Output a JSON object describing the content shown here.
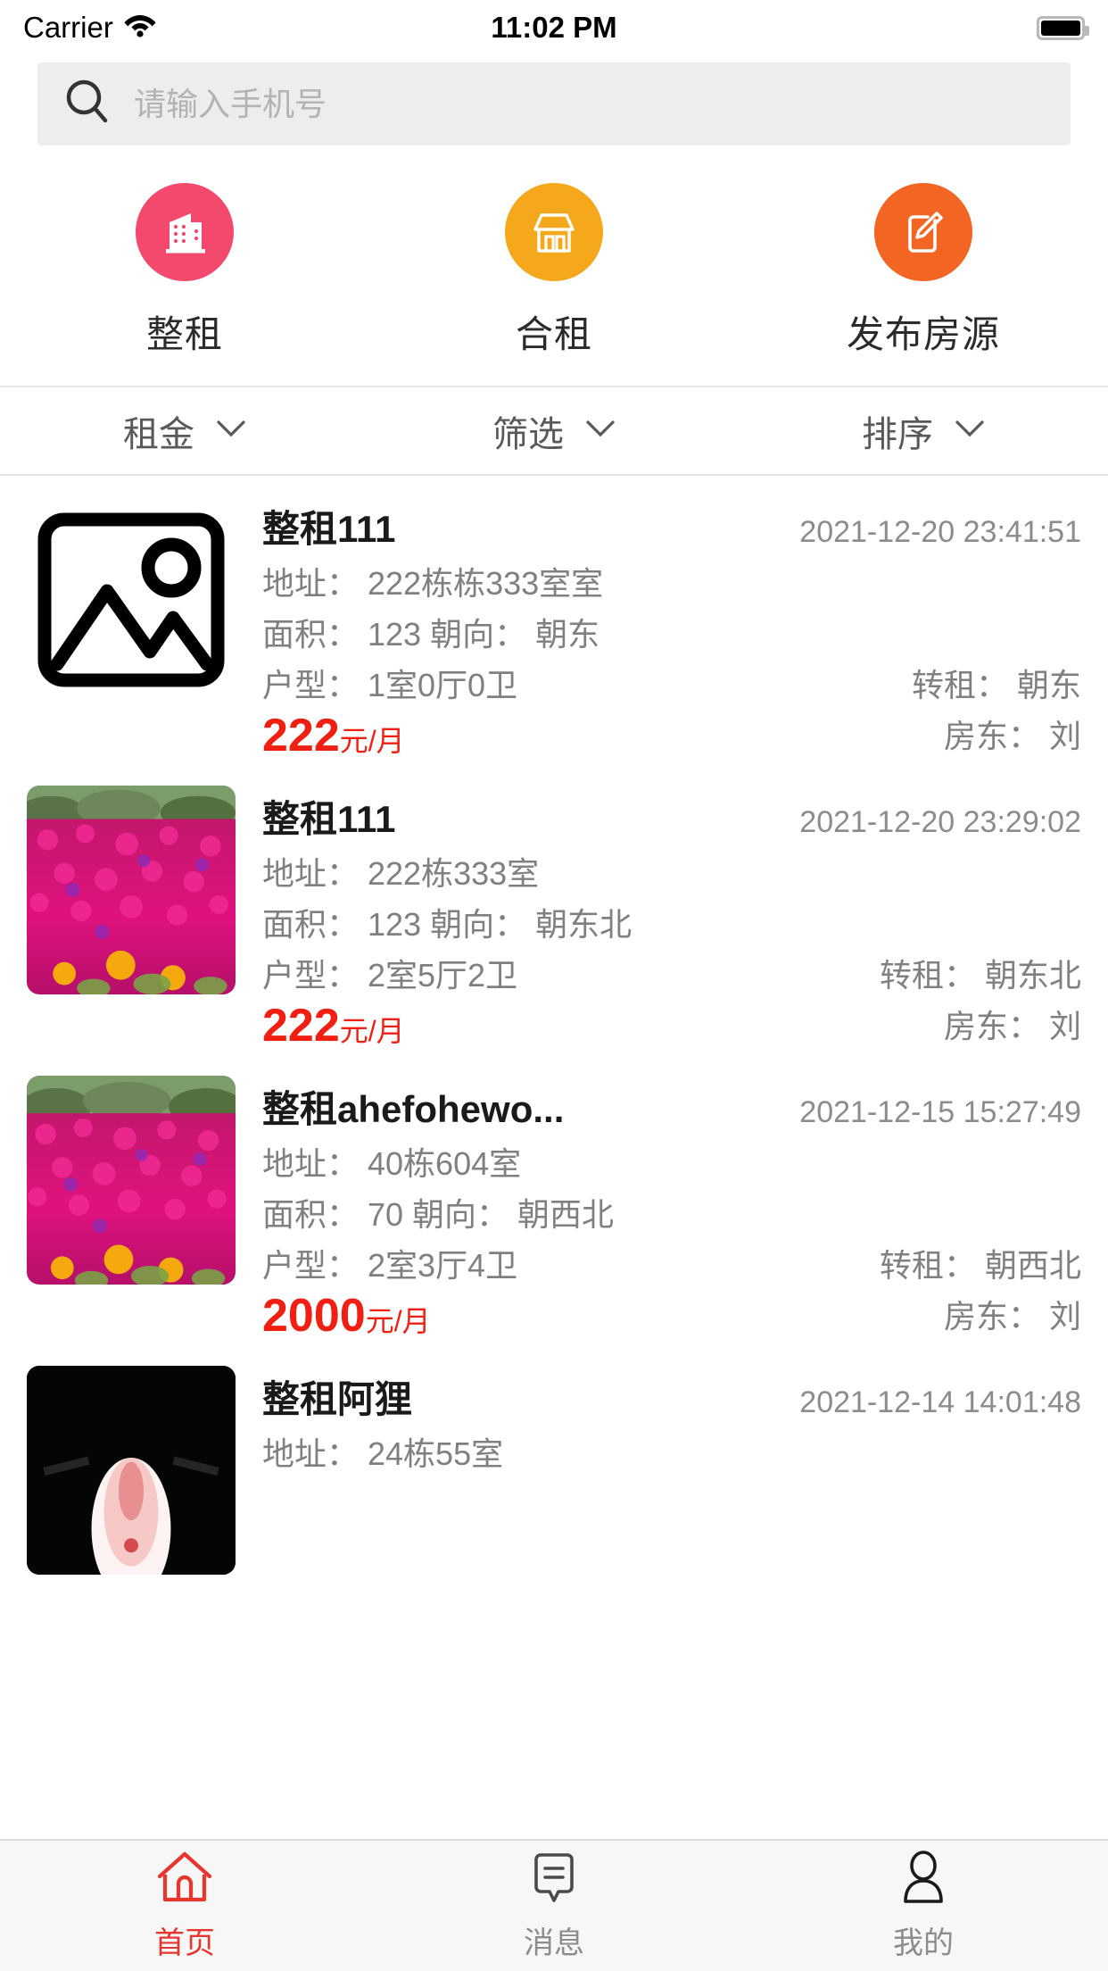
{
  "status_bar": {
    "carrier": "Carrier",
    "wifi_icon": "wifi-icon",
    "time": "11:02 PM",
    "battery_icon": "battery-icon"
  },
  "search": {
    "icon": "search-icon",
    "placeholder": "请输入手机号",
    "value": ""
  },
  "categories": [
    {
      "label": "整租",
      "icon": "building-icon",
      "color": "#F2496D"
    },
    {
      "label": "合租",
      "icon": "shop-icon",
      "color": "#F5A81C"
    },
    {
      "label": "发布房源",
      "icon": "edit-square-icon",
      "color": "#F26522"
    }
  ],
  "filters": [
    {
      "label": "租金",
      "icon": "chevron-down-icon"
    },
    {
      "label": "筛选",
      "icon": "chevron-down-icon"
    },
    {
      "label": "排序",
      "icon": "chevron-down-icon"
    }
  ],
  "labels": {
    "address": "地址：",
    "area": "面积：",
    "orientation": "朝向：",
    "layout": "户型：",
    "sublet": "转租：",
    "landlord": "房东：",
    "price_unit": "元/月"
  },
  "listings": [
    {
      "title": "整租111",
      "time": "2021-12-20 23:41:51",
      "address": "地址： 222栋栋333室室",
      "area_line": "面积： 123    朝向： 朝东",
      "layout": "户型： 1室0厅0卫",
      "sublet": "转租： 朝东",
      "price": "222",
      "price_unit": "元/月",
      "landlord": "房东： 刘",
      "thumb": "placeholder-image"
    },
    {
      "title": "整租111",
      "time": "2021-12-20 23:29:02",
      "address": "地址： 222栋333室",
      "area_line": "面积： 123    朝向： 朝东北",
      "layout": "户型： 2室5厅2卫",
      "sublet": "转租： 朝东北",
      "price": "222",
      "price_unit": "元/月",
      "landlord": "房东： 刘",
      "thumb": "flowers-photo"
    },
    {
      "title": "整租ahefohewo...",
      "time": "2021-12-15 15:27:49",
      "address": "地址： 40栋604室",
      "area_line": "面积： 70    朝向： 朝西北",
      "layout": "户型： 2室3厅4卫",
      "sublet": "转租： 朝西北",
      "price": "2000",
      "price_unit": "元/月",
      "landlord": "房东： 刘",
      "thumb": "flowers-photo"
    },
    {
      "title": "整租阿狸",
      "time": "2021-12-14 14:01:48",
      "address": "地址： 24栋55室",
      "area_line": "",
      "layout": "",
      "sublet": "",
      "price": "",
      "price_unit": "",
      "landlord": "",
      "thumb": "dark-photo"
    }
  ],
  "tabbar": [
    {
      "label": "首页",
      "icon": "home-icon",
      "active": true,
      "color": "#E8362E"
    },
    {
      "label": "消息",
      "icon": "message-icon",
      "active": false,
      "color": "#8C8C8C"
    },
    {
      "label": "我的",
      "icon": "person-icon",
      "active": false,
      "color": "#8C8C8C"
    }
  ]
}
